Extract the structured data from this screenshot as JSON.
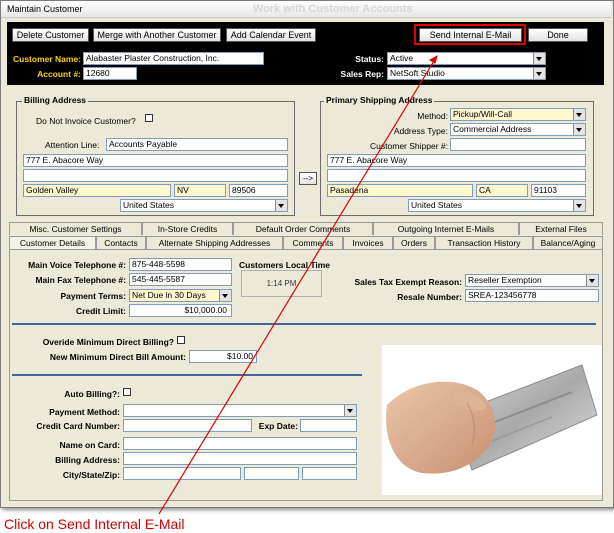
{
  "window": {
    "title": "Maintain Customer",
    "ghost_title": "Work with Customer Accounts"
  },
  "toolbar": {
    "delete_label": "Delete Customer",
    "merge_label": "Merge with Another Customer",
    "calendar_label": "Add Calendar Event",
    "send_email_label": "Send Internal E-Mail",
    "done_label": "Done"
  },
  "header": {
    "customer_name_label": "Customer Name:",
    "customer_name": "Alabaster Plaster Construction, Inc.",
    "account_label": "Account #:",
    "account": "12680",
    "status_label": "Status:",
    "status": "Active",
    "sales_rep_label": "Sales Rep:",
    "sales_rep": "NetSoft Studio"
  },
  "billing": {
    "title": "Billing Address",
    "do_not_invoice_label": "Do Not Invoice Customer?",
    "attention_label": "Attention Line:",
    "attention": "Accounts Payable",
    "line1": "777 E. Abacore Way",
    "line2": "",
    "city": "Golden Valley",
    "state": "NV",
    "zip": "89506",
    "country": "United States",
    "copy_button": "-->"
  },
  "shipping": {
    "title": "Primary Shipping Address",
    "method_label": "Method:",
    "method": "Pickup/Will-Call",
    "address_type_label": "Address Type:",
    "address_type": "Commercial Address",
    "shipper_label": "Customer Shipper #:",
    "shipper": "",
    "line1": "777 E. Abacore Way",
    "line2": "",
    "city": "Pasadena",
    "state": "CA",
    "zip": "91103",
    "country": "United States"
  },
  "tabs_row1": [
    "Misc. Customer Settings",
    "In-Store Credits",
    "Default Order Comments",
    "Outgoing Internet E-Mails",
    "External Files"
  ],
  "tabs_row2": [
    "Customer Details",
    "Contacts",
    "Alternate Shipping Addresses",
    "Comments",
    "Invoices",
    "Orders",
    "Transaction History",
    "Balance/Aging"
  ],
  "details": {
    "voice_label": "Main Voice Telephone #:",
    "voice": "875-448-5598",
    "fax_label": "Main Fax Telephone #:",
    "fax": "545-445-5587",
    "terms_label": "Payment Terms:",
    "terms": "Net Due in 30 Days",
    "credit_label": "Credit Limit:",
    "credit": "$10,000.00",
    "local_time_label": "Customers Local Time",
    "local_time": "1:14 PM",
    "tax_label": "Sales Tax Exempt Reason:",
    "tax": "Reseller Exemption",
    "resale_label": "Resale Number:",
    "resale": "SREA-123456778",
    "override_label": "Overide Minimum Direct Billing?",
    "min_bill_label": "New Minimum Direct Bill Amount:",
    "min_bill": "$10.00",
    "auto_billing_label": "Auto Billing?:",
    "payment_method_label": "Payment Method:",
    "cc_label": "Credit Card Number:",
    "exp_label": "Exp Date:",
    "name_label": "Name on Card:",
    "bill_addr_label": "Billing Address:",
    "csz_label": "City/State/Zip:"
  },
  "annotation": {
    "caption": "Click on Send Internal E-Mail"
  },
  "colors": {
    "header_bg": "#000000",
    "label_yellow": "#ffd200",
    "highlight_field": "#fff8cf",
    "annotation_red": "#d60000",
    "separator_blue": "#42669a"
  }
}
